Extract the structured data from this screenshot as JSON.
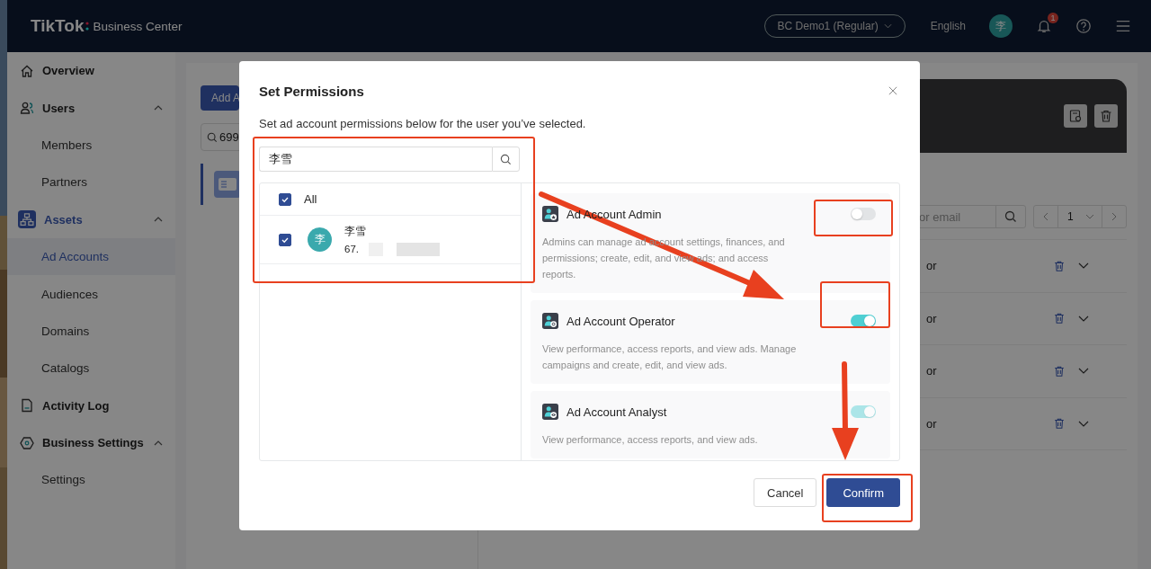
{
  "header": {
    "logo": "TikTok",
    "product": "Business Center",
    "account": "BC Demo1 (Regular)",
    "language": "English",
    "avatar": "李",
    "notifications": "1"
  },
  "sidebar": [
    {
      "label": "Overview",
      "kind": "home",
      "selected": false
    },
    {
      "label": "Users",
      "kind": "users",
      "selected": false,
      "expanded": true,
      "children": [
        {
          "label": "Members",
          "selected": false
        },
        {
          "label": "Partners",
          "selected": false
        }
      ]
    },
    {
      "label": "Assets",
      "kind": "assets",
      "selected": true,
      "expanded": true,
      "children": [
        {
          "label": "Ad Accounts",
          "selected": true
        },
        {
          "label": "Audiences",
          "selected": false
        },
        {
          "label": "Domains",
          "selected": false
        },
        {
          "label": "Catalogs",
          "selected": false
        }
      ]
    },
    {
      "label": "Activity Log",
      "kind": "log",
      "selected": false
    },
    {
      "label": "Business Settings",
      "kind": "settings",
      "selected": false,
      "expanded": true,
      "children": [
        {
          "label": "Settings",
          "selected": false
        }
      ]
    }
  ],
  "background": {
    "add_button": "Add A",
    "search_value": "699",
    "member_search_placeholder": "or email",
    "page": "1",
    "rows": [
      {
        "column_1": "or"
      },
      {
        "column_1": "or"
      },
      {
        "column_1": "or"
      },
      {
        "column_1": "or"
      }
    ]
  },
  "dialog": {
    "title": "Set Permissions",
    "subtitle": "Set ad account permissions below for the user you’ve selected.",
    "search": {
      "value": "李雪"
    },
    "users": [
      {
        "kind": "all",
        "label": "All",
        "checked": true
      },
      {
        "kind": "user",
        "avatar": "李",
        "name": "李雪",
        "id": "67.",
        "checked": true
      }
    ],
    "roles": [
      {
        "kind": "admin",
        "title": "Ad Account Admin",
        "description": "Admins can manage ad account settings, finances, and permissions; create, edit, and view ads; and access reports.",
        "on": false,
        "disabled": false
      },
      {
        "kind": "operator",
        "title": "Ad Account Operator",
        "description": "View performance, access reports, and view ads. Manage campaigns and create, edit, and view ads.",
        "on": true,
        "disabled": false
      },
      {
        "kind": "analyst",
        "title": "Ad Account Analyst",
        "description": "View performance, access reports, and view ads.",
        "on": true,
        "disabled": true
      }
    ],
    "buttons": [
      {
        "kind": "secondary",
        "label": "Cancel"
      },
      {
        "kind": "primary",
        "label": "Confirm"
      }
    ]
  }
}
